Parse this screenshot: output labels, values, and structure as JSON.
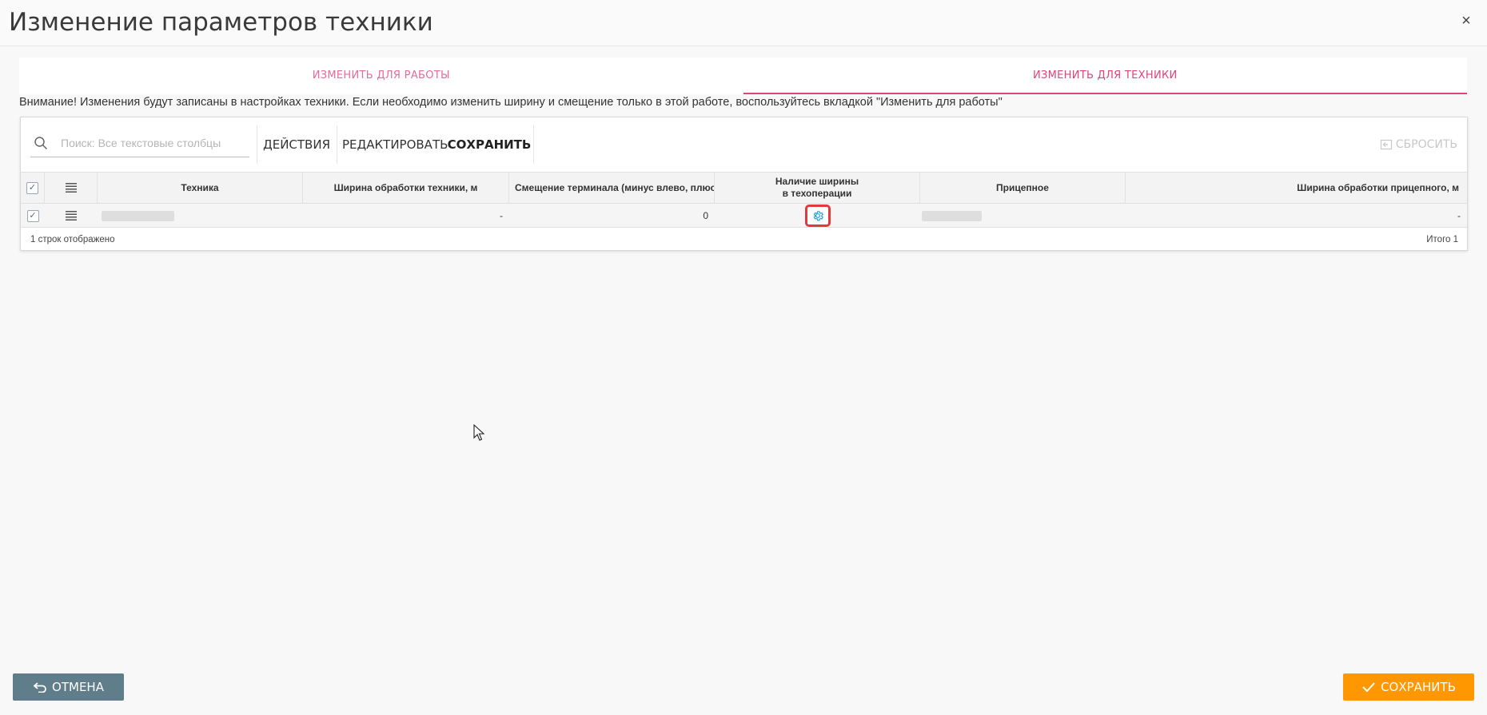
{
  "window": {
    "title": "Изменение параметров техники",
    "close_label": "×"
  },
  "tabs": [
    {
      "label": "ИЗМЕНИТЬ ДЛЯ РАБОТЫ",
      "active": false
    },
    {
      "label": "ИЗМЕНИТЬ ДЛЯ ТЕХНИКИ",
      "active": true
    }
  ],
  "notice": "Внимание! Изменения будут записаны в настройках техники. Если необходимо изменить ширину и смещение только в этой работе, воспользуйтесь вкладкой \"Изменить для работы\"",
  "toolbar": {
    "search_placeholder": "Поиск: Все текстовые столбцы",
    "actions_label": "ДЕЙСТВИЯ",
    "edit_label": "РЕДАКТИРОВАТЬ",
    "save_label": "СОХРАНИТЬ",
    "reset_label": "СБРОСИТЬ"
  },
  "table": {
    "columns": [
      "Техника",
      "Ширина обработки техники, м",
      "Смещение терминала (минус влево, плюс вп",
      "Наличие ширины\nв техоперации",
      "Прицепное",
      "Ширина обработки прицепного, м"
    ],
    "rows": [
      {
        "technique": "",
        "width": "-",
        "offset": "0",
        "has_width_icon": "gear-icon",
        "trailer": "",
        "trailer_width": "-"
      }
    ],
    "footer_left": "1 строк отображено",
    "footer_right": "Итого 1"
  },
  "buttons": {
    "cancel": "ОТМЕНА",
    "save": "СОХРАНИТЬ"
  },
  "colors": {
    "tab_accent": "#e0437a",
    "cancel_bg": "#607d8b",
    "save_bg": "#ff9800",
    "highlight": "#e03a3a",
    "gear": "#29a3d6"
  }
}
